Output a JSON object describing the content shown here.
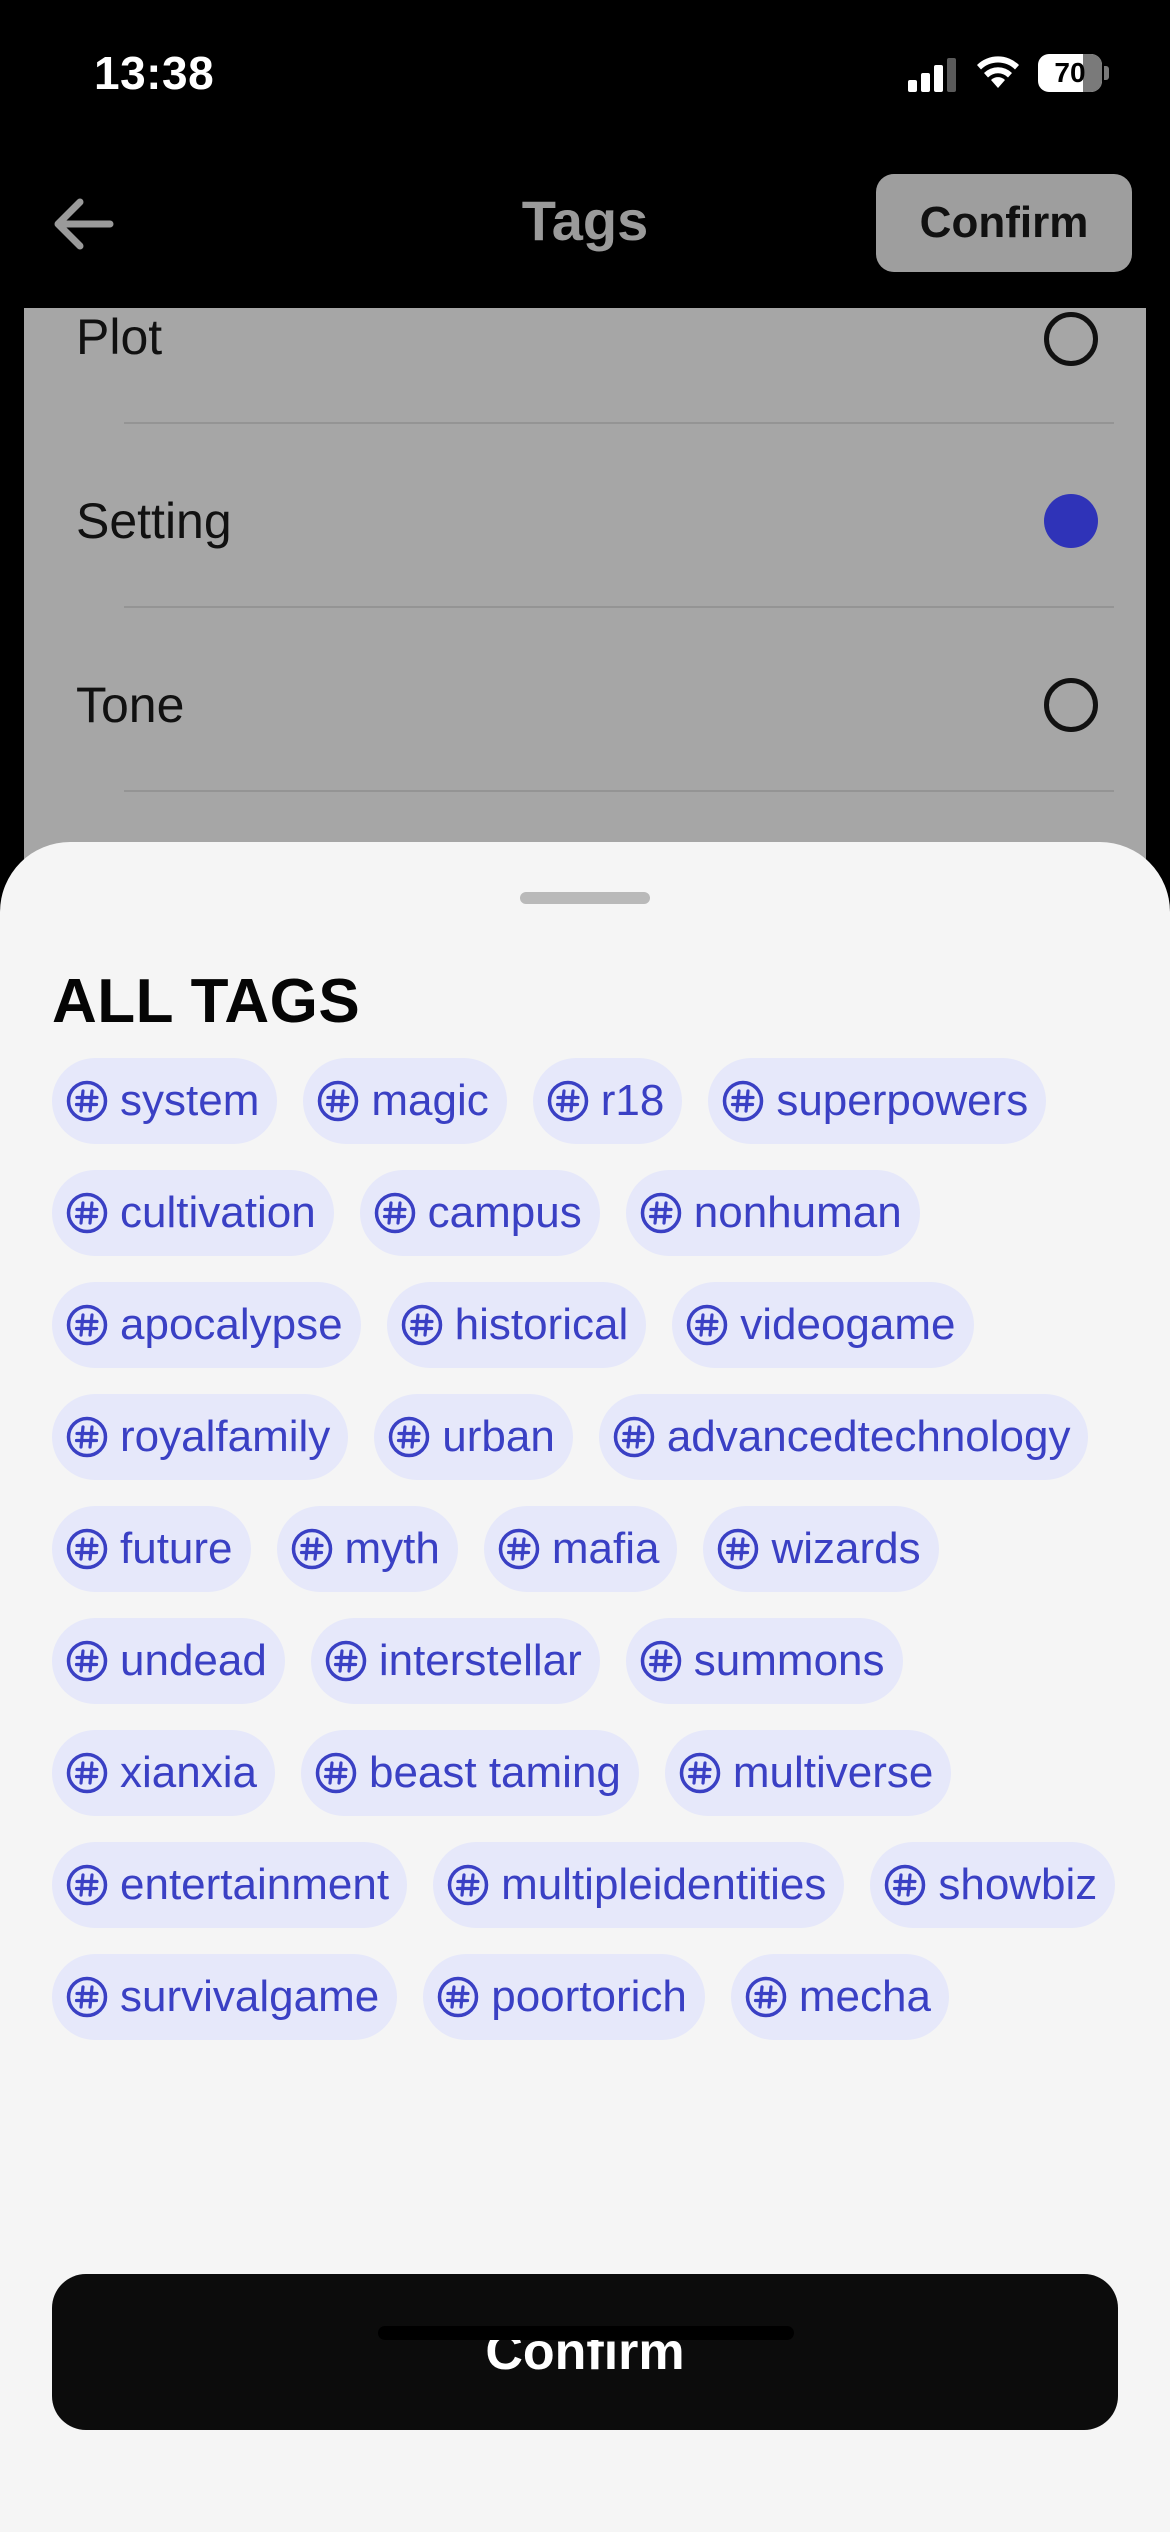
{
  "status_bar": {
    "time": "13:38",
    "battery_level": "70",
    "battery_fraction": 0.7
  },
  "header": {
    "title": "Tags",
    "confirm_label": "Confirm",
    "back_icon": "arrow-left-icon"
  },
  "background_list": {
    "items": [
      {
        "label": "Plot",
        "selected": false
      },
      {
        "label": "Setting",
        "selected": true
      },
      {
        "label": "Tone",
        "selected": false
      }
    ]
  },
  "sheet": {
    "title": "ALL TAGS",
    "tag_icon": "hash-icon",
    "tags": [
      "system",
      "magic",
      "r18",
      "superpowers",
      "cultivation",
      "campus",
      "nonhuman",
      "apocalypse",
      "historical",
      "videogame",
      "royalfamily",
      "urban",
      "advancedtechnology",
      "future",
      "myth",
      "mafia",
      "wizards",
      "undead",
      "interstellar",
      "summons",
      "xianxia",
      "beast taming",
      "multiverse",
      "entertainment",
      "multipleidentities",
      "showbiz",
      "survivalgame",
      "poortorich",
      "mecha"
    ],
    "confirm_label": "Confirm"
  },
  "colors": {
    "accent": "#3a40c4",
    "tag_background": "#e6e8fa",
    "selected_radio": "#2f33b8",
    "sheet_background": "#f5f5f5"
  }
}
